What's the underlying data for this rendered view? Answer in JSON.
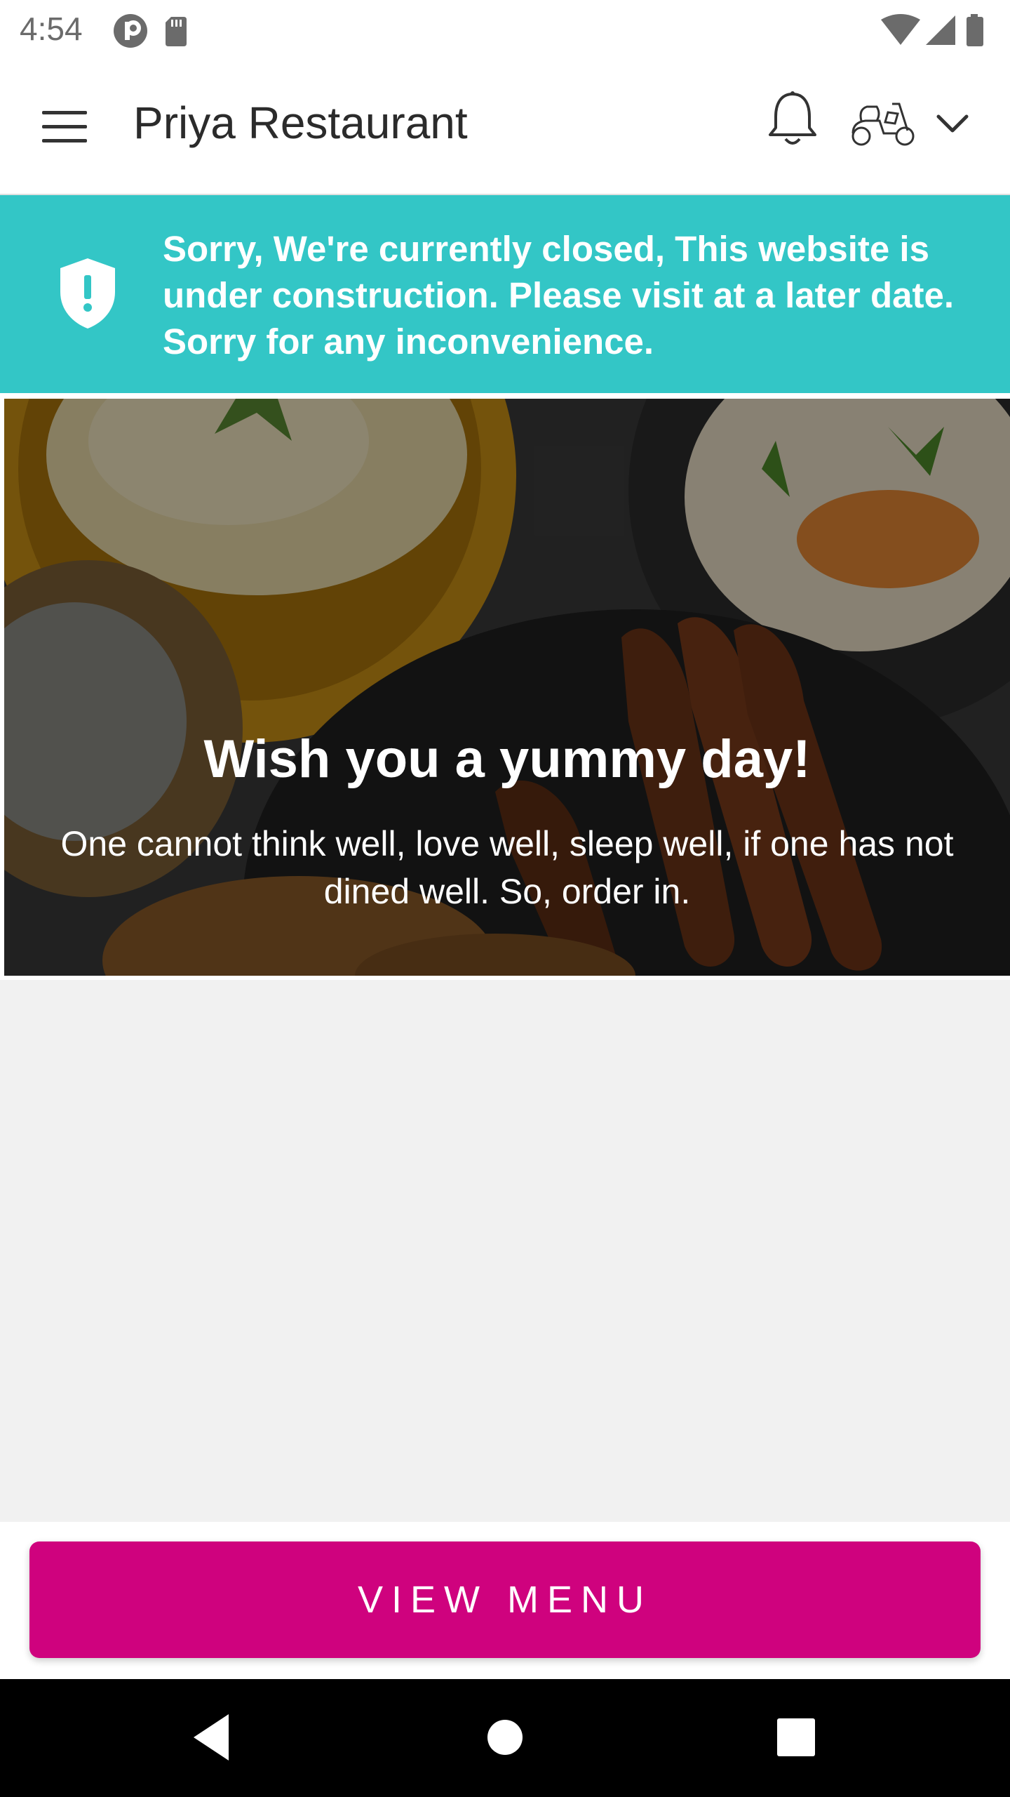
{
  "status_bar": {
    "time": "4:54",
    "left_icons": [
      "p-circle-icon",
      "sd-card-icon"
    ],
    "right_icons": [
      "wifi-icon",
      "signal-icon",
      "battery-icon"
    ]
  },
  "app_bar": {
    "title": "Priya Restaurant",
    "icons": [
      "menu-icon",
      "bell-icon",
      "scooter-icon",
      "chevron-down-icon"
    ]
  },
  "notice": {
    "text": "Sorry, We're currently closed, This website is under construction. Please visit at a later date. Sorry for any inconvenience.",
    "icon": "shield-alert-icon",
    "background": "#33c6c6"
  },
  "hero": {
    "title": "Wish you a yummy day!",
    "subtitle": "One cannot think well, love well, sleep well, if one has not dined well. So, order in."
  },
  "cta": {
    "label": "VIEW MENU",
    "color": "#cf027e"
  },
  "nav_bar": {
    "icons": [
      "back-icon",
      "home-icon",
      "recents-icon"
    ]
  }
}
